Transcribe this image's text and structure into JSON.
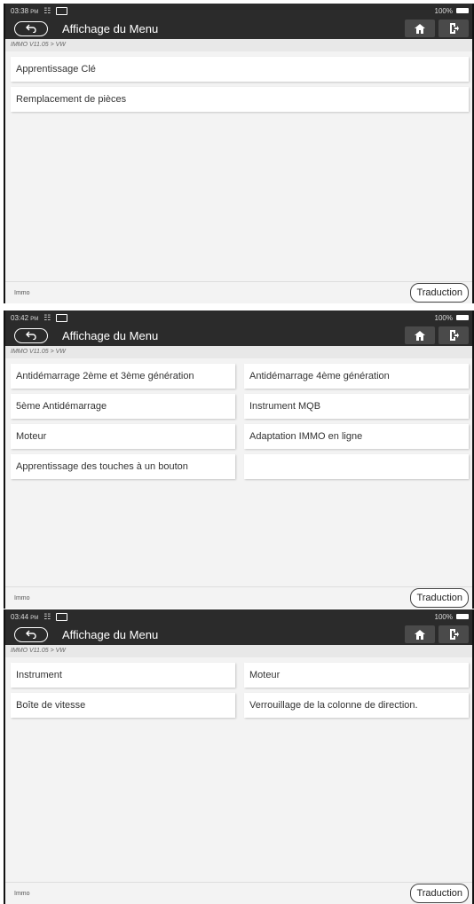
{
  "screens": [
    {
      "status": {
        "time": "03:38",
        "ampm": "PM",
        "battery": "100%"
      },
      "title": "Affichage du Menu",
      "breadcrumb": "IMMO V11.05 > VW",
      "items": [
        {
          "label": "Apprentissage Clé"
        },
        {
          "label": "Remplacement de pièces"
        }
      ],
      "footer": {
        "label": "Immo",
        "button": "Traduction"
      }
    },
    {
      "status": {
        "time": "03:42",
        "ampm": "PM",
        "battery": "100%"
      },
      "title": "Affichage du Menu",
      "breadcrumb": "IMMO V11.05 > VW",
      "items": [
        {
          "label": "Antidémarrage 2ème et 3ème génération"
        },
        {
          "label": "Antidémarrage 4ème génération"
        },
        {
          "label": "5ème Antidémarrage"
        },
        {
          "label": "Instrument MQB"
        },
        {
          "label": "Moteur"
        },
        {
          "label": "Adaptation IMMO en ligne"
        },
        {
          "label": "Apprentissage des touches à un bouton"
        },
        {
          "label": ""
        }
      ],
      "footer": {
        "label": "Immo",
        "button": "Traduction"
      }
    },
    {
      "status": {
        "time": "03:44",
        "ampm": "PM",
        "battery": "100%"
      },
      "title": "Affichage du Menu",
      "breadcrumb": "IMMO V11.05 > VW",
      "items": [
        {
          "label": "Instrument"
        },
        {
          "label": "Moteur"
        },
        {
          "label": "Boîte de vitesse"
        },
        {
          "label": "Verrouillage de la colonne de direction."
        }
      ],
      "footer": {
        "label": "Immo",
        "button": "Traduction"
      }
    }
  ],
  "icons": {
    "back": "back-arrow-icon",
    "home": "home-icon",
    "exit": "exit-icon",
    "wifi": "wifi-icon",
    "battery": "battery-icon"
  },
  "colors": {
    "topbar": "#2b2b2b",
    "background": "#f3f3f3",
    "item": "#ffffff"
  }
}
